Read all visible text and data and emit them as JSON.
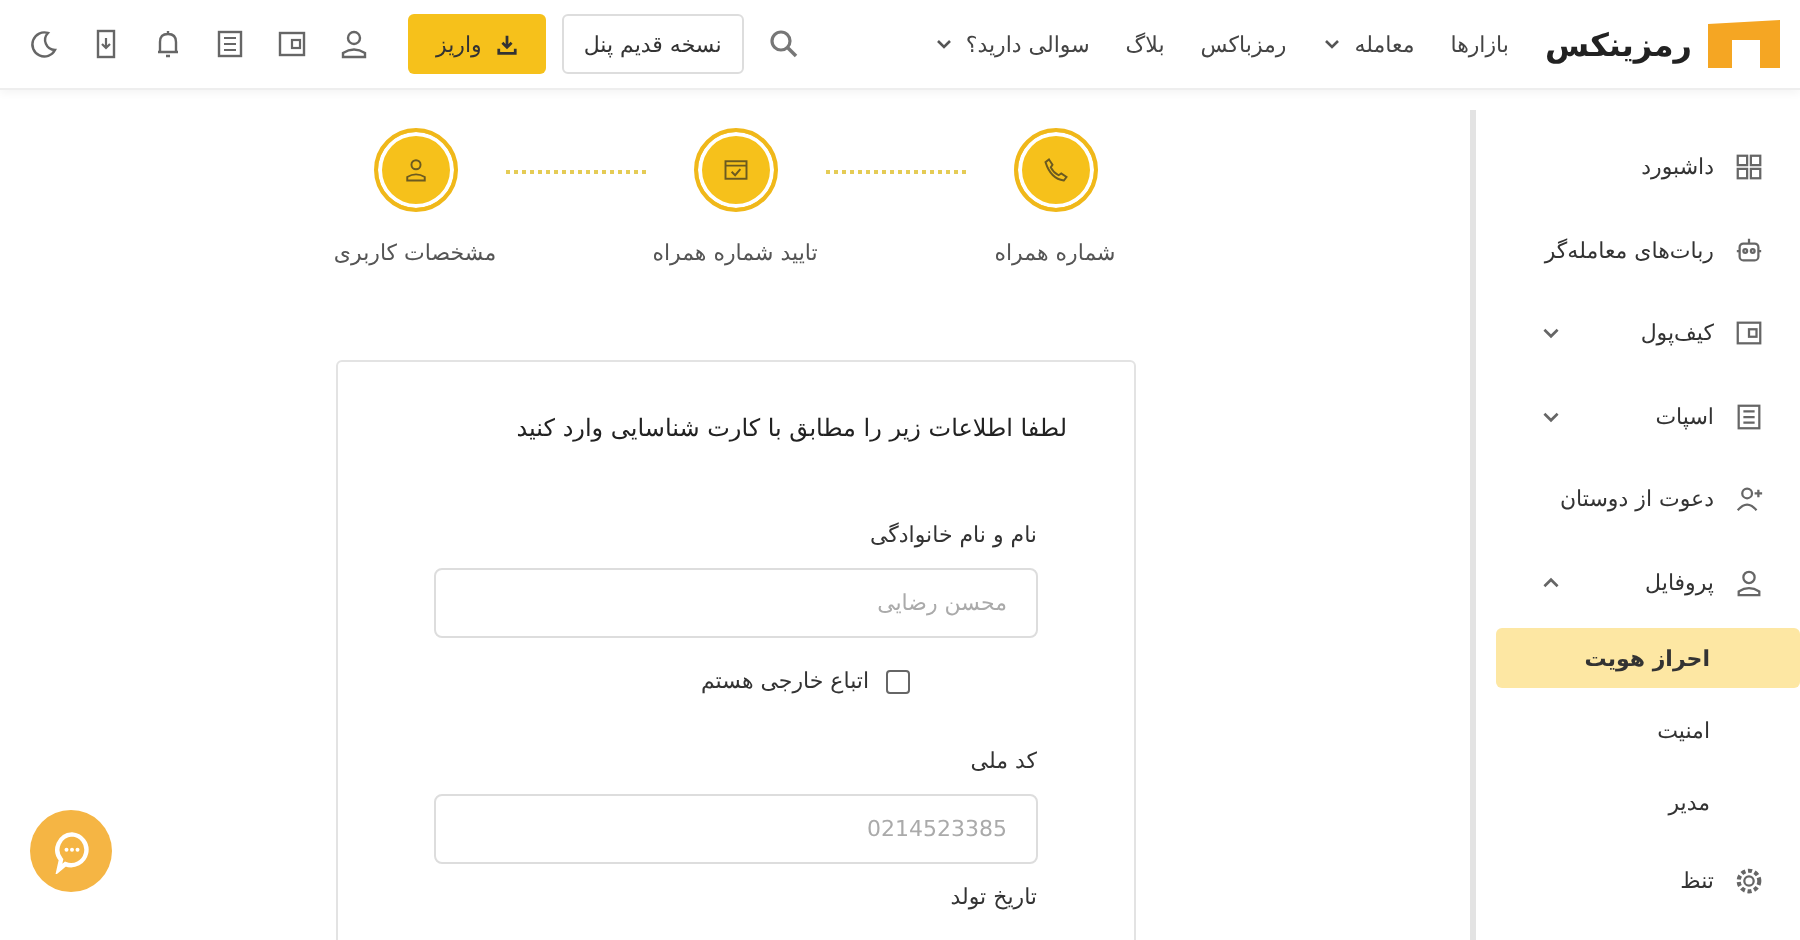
{
  "header": {
    "logo": "رمزینکس",
    "nav": [
      {
        "label": "بازارها",
        "dropdown": false
      },
      {
        "label": "معامله",
        "dropdown": true
      },
      {
        "label": "رمزباکس",
        "dropdown": false
      },
      {
        "label": "بلاگ",
        "dropdown": false
      },
      {
        "label": "سوالی دارید؟",
        "dropdown": true
      }
    ],
    "old_panel_button": "نسخه قدیم پنل",
    "deposit_button": "واریز"
  },
  "sidebar": {
    "items": [
      {
        "label": "داشبورد"
      },
      {
        "label": "ربات‌های معامله‌گر"
      },
      {
        "label": "کیف‌پول",
        "expanded": false
      },
      {
        "label": "اسپات",
        "expanded": false
      },
      {
        "label": "دعوت از دوستان"
      },
      {
        "label": "پروفایل",
        "expanded": true,
        "children": [
          {
            "label": "احراز هویت",
            "selected": true
          },
          {
            "label": "امنیت",
            "selected": false
          },
          {
            "label": "مدیر",
            "selected": false
          }
        ]
      },
      {
        "label": "تنظ"
      }
    ]
  },
  "stepper": [
    {
      "label": "شماره همراه",
      "done": true
    },
    {
      "label": "تایید شماره همراه",
      "done": true
    },
    {
      "label": "مشخصات کاربری",
      "done": true
    }
  ],
  "form": {
    "title": "لطفا اطلاعات زیر را مطابق با کارت شناسایی وارد کنید",
    "fields": [
      {
        "kind": "text",
        "label": "نام و نام خانوادگی",
        "placeholder": "محسن رضایی"
      },
      {
        "kind": "checkbox",
        "label": "اتباع خارجی هستم",
        "checked": false
      },
      {
        "kind": "text",
        "label": "کد ملی",
        "placeholder": "0214523385"
      },
      {
        "kind": "label",
        "label": "تاریخ تولد"
      }
    ]
  }
}
